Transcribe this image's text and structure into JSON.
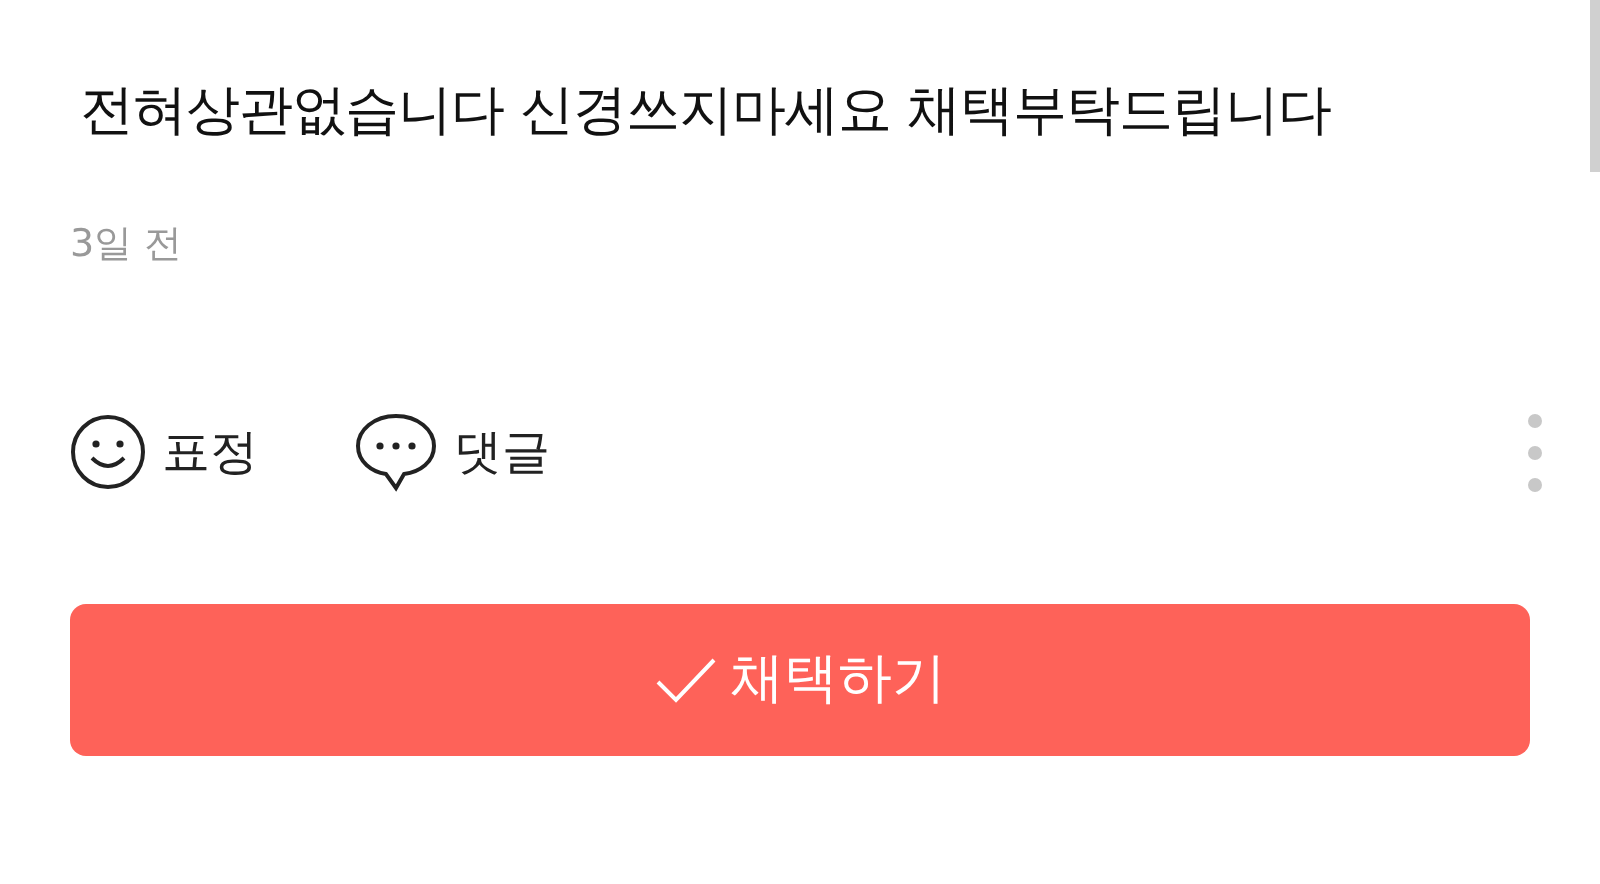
{
  "answer": {
    "text": "전혀상관없습니다 신경쓰지마세요 채택부탁드립니다",
    "time": "3일 전"
  },
  "actions": [
    {
      "kind": "emoji",
      "label": "표정"
    },
    {
      "kind": "comment",
      "label": "댓글"
    }
  ],
  "accept_button": {
    "label": "채택하기"
  }
}
